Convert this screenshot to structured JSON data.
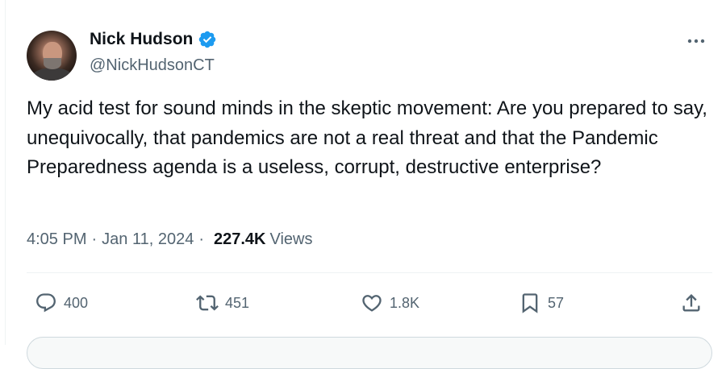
{
  "author": {
    "display_name": "Nick Hudson",
    "handle": "@NickHudsonCT",
    "verified_icon": "verified-badge-icon",
    "avatar_icon": "avatar-photo"
  },
  "tweet": {
    "text": "My acid test for sound minds in the skeptic movement: Are you prepared to say, unequivocally, that pandemics are not a real threat and that the Pandemic Preparedness agenda is a useless, corrupt, destructive enterprise?",
    "time": "4:05 PM",
    "separator": "·",
    "date": "Jan 11, 2024",
    "views_count": "227.4K",
    "views_label": "Views"
  },
  "actions": {
    "reply": {
      "icon": "reply-icon",
      "count": "400"
    },
    "retweet": {
      "icon": "retweet-icon",
      "count": "451"
    },
    "like": {
      "icon": "heart-icon",
      "count": "1.8K"
    },
    "bookmark": {
      "icon": "bookmark-icon",
      "count": "57"
    },
    "share": {
      "icon": "share-icon"
    }
  },
  "colors": {
    "text_primary": "#0f1419",
    "text_secondary": "#536471",
    "verified_blue": "#1d9bf0",
    "divider": "#eff3f4"
  }
}
